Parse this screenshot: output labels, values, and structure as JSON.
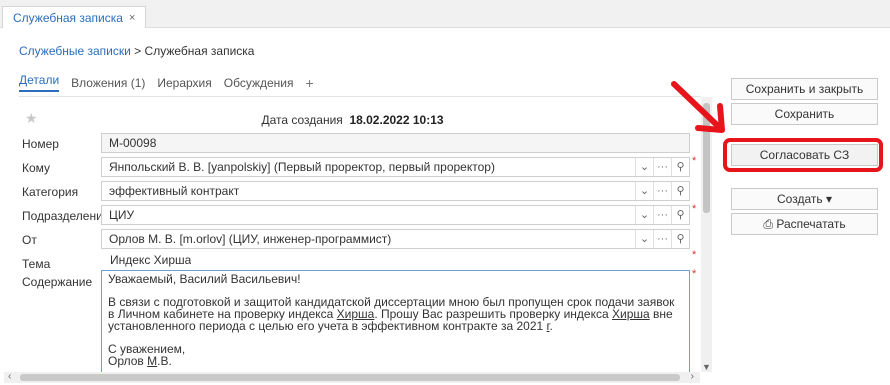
{
  "top_tab": {
    "label": "Служебная записка",
    "close": "×"
  },
  "breadcrumb": {
    "parent": "Служебные записки",
    "separator": " > ",
    "current": "Служебная записка"
  },
  "tabs": [
    {
      "label": "Детали",
      "active": true
    },
    {
      "label": "Вложения (1)"
    },
    {
      "label": "Иерархия"
    },
    {
      "label": "Обсуждения"
    }
  ],
  "add_tab": "+",
  "created": {
    "label": "Дата создания",
    "value": "18.02.2022 10:13"
  },
  "fields": {
    "number": {
      "label": "Номер",
      "value": "М-00098"
    },
    "to": {
      "label": "Кому",
      "value": "Янпольский В. В. [yanpolskiy] (Первый проректор, первый проректор)"
    },
    "category": {
      "label": "Категория",
      "value": "эффективный контракт"
    },
    "department": {
      "label": "Подразделение",
      "value": "ЦИУ"
    },
    "from": {
      "label": "От",
      "value": "Орлов М. В. [m.orlov] (ЦИУ, инженер-программист)"
    },
    "subject": {
      "label": "Тема",
      "value": "Индекс Хирша"
    },
    "content": {
      "label": "Содержание",
      "line1": "Уважаемый, Василий Васильевич!",
      "para_a": "В связи с подготовкой и защитой кандидатской диссертации мною был пропущен срок подачи заявок в Личном кабинете на проверку индекса ",
      "word_hirsch": "Хирша",
      "para_b": ". Прошу Вас разрешить проверку индекса ",
      "para_c": " вне установленного периода с целью его учета в эффективном контракте за 2021 ",
      "year_suffix": "г",
      "para_end": ".",
      "sign1": "С уважением,",
      "sign2a": "Орлов ",
      "sign2b": "М",
      "sign2c": ".В."
    }
  },
  "field_buttons": {
    "dropdown": "⌄",
    "more": "···",
    "search": "⚲"
  },
  "required_mark": "*",
  "actions": {
    "save_close": "Сохранить и закрыть",
    "save": "Сохранить",
    "approve": "Согласовать СЗ",
    "create": "Создать",
    "create_caret": "▾",
    "print": "Распечатать",
    "print_icon": "⎙"
  },
  "colors": {
    "accent": "#2a6ebb",
    "highlight": "#e8141c",
    "required": "#d33333"
  }
}
